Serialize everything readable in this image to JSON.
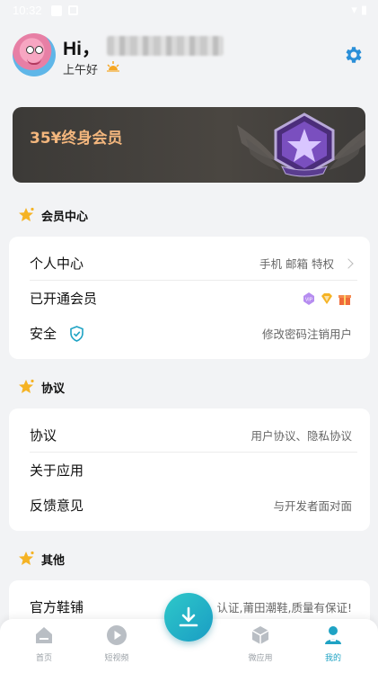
{
  "status_bar": {
    "time": "10:32"
  },
  "header": {
    "greeting": "Hi，",
    "subgreeting": "上午好"
  },
  "banner": {
    "title": "35¥终身会员"
  },
  "sections": {
    "member_center": {
      "title": "会员中心"
    },
    "agreement": {
      "title": "协议"
    },
    "other": {
      "title": "其他"
    }
  },
  "member_rows": {
    "personal_center": {
      "label": "个人中心",
      "value": "手机 邮箱 特权"
    },
    "activated_membership": {
      "label": "已开通会员"
    },
    "security": {
      "label": "安全",
      "value_change_password": "修改密码",
      "value_cancel_user": "注销用户"
    }
  },
  "agreement_rows": {
    "agreement": {
      "label": "协议",
      "value": "用户协议、隐私协议"
    },
    "about_app": {
      "label": "关于应用"
    },
    "feedback": {
      "label": "反馈意见",
      "value": "与开发者面对面"
    }
  },
  "other_rows": {
    "official_store": {
      "label": "官方鞋铺",
      "value": "认证,莆田潮鞋,质量有保证!"
    }
  },
  "bottom_nav": {
    "home": "首页",
    "short_video": "短视频",
    "apps": "微应用",
    "mine": "我的"
  },
  "colors": {
    "accent": "#1fa3c4",
    "gear": "#2a8fd8",
    "banner_text": "#f3b67d",
    "shield": "#1fa3c4",
    "star": "#f5b324"
  }
}
